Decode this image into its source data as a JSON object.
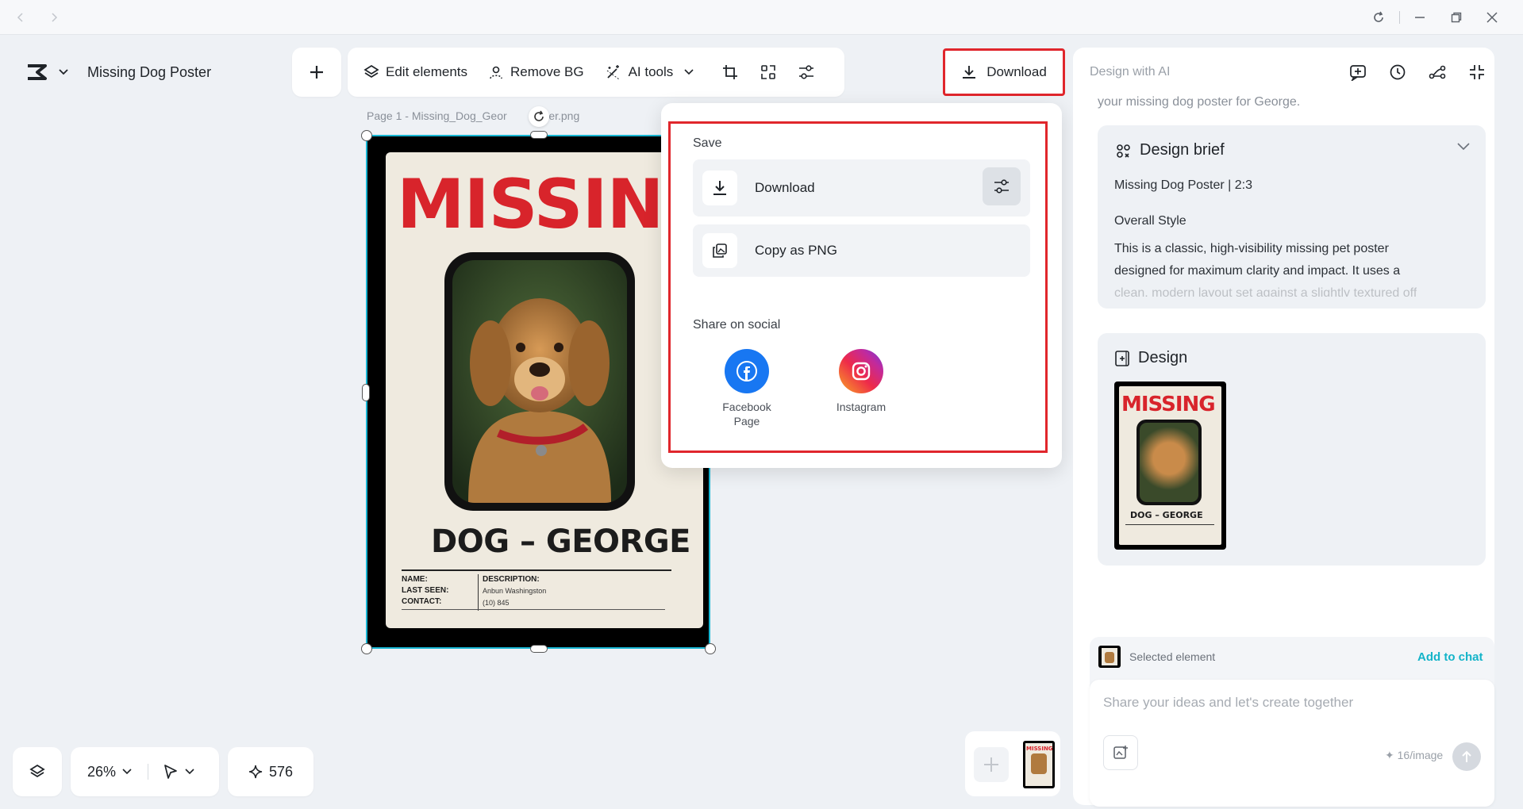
{
  "titlebar": {
    "back_icon": "chevron-left-icon",
    "forward_icon": "chevron-right-icon",
    "refresh_icon": "refresh-icon",
    "minimize_icon": "minimize-icon",
    "restore_icon": "restore-icon",
    "close_icon": "close-icon"
  },
  "project": {
    "title": "Missing Dog Poster"
  },
  "toolbar": {
    "edit_elements": "Edit elements",
    "remove_bg": "Remove BG",
    "ai_tools": "AI tools",
    "download": "Download"
  },
  "canvas": {
    "page_label": "Page 1 -   Missing_Dog_Geor",
    "page_label_tail": "oster.png",
    "poster": {
      "headline": "MISSING",
      "dog_name": "DOG – GEORGE",
      "name_label": "NAME:",
      "last_seen_label": "LAST SEEN:",
      "contact_label": "CONTACT:",
      "description_label": "DESCRIPTION:",
      "last_seen_value": "Anbun Washingston",
      "contact_value": "(10) 845"
    }
  },
  "download_menu": {
    "save_section": "Save",
    "download_label": "Download",
    "copy_png_label": "Copy as PNG",
    "share_section": "Share on social",
    "facebook_label_1": "Facebook",
    "facebook_label_2": "Page",
    "instagram_label": "Instagram"
  },
  "right_panel": {
    "title": "Design with AI",
    "faded_line": "your missing dog poster for George.",
    "brief": {
      "title": "Design brief",
      "subtitle": "Missing Dog Poster | 2:3",
      "style_heading": "Overall Style",
      "style_text_1": "This is a classic, high-visibility missing pet poster",
      "style_text_2": "designed for maximum clarity and impact. It uses a",
      "style_text_3": "clean, modern layout set against a slightly textured off"
    },
    "design_card": {
      "title": "Design",
      "thumb_headline": "MISSING",
      "thumb_name": "DOG – GEORGE"
    },
    "chat": {
      "selected_element": "Selected element",
      "add_to_chat": "Add to chat",
      "placeholder": "Share your ideas and let's create together",
      "credit_cost": "✦ 16/image"
    }
  },
  "bottom_bar": {
    "zoom": "26%",
    "credits": "576"
  },
  "pages_strip": {
    "thumb_headline": "MISSING"
  },
  "colors": {
    "accent": "#14b4c9",
    "highlight": "#e0262c",
    "poster_red": "#d8242b",
    "facebook": "#1877f2"
  }
}
